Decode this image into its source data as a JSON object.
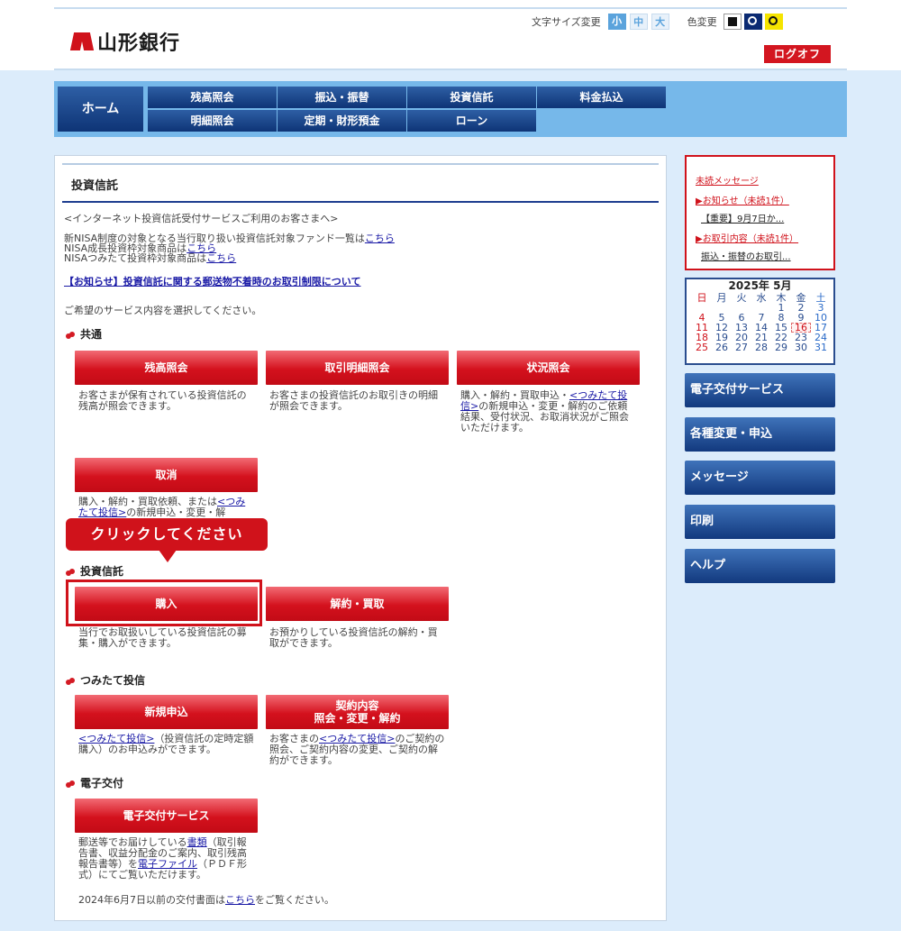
{
  "header": {
    "bank_name": "山形銀行",
    "font_size_label": "文字サイズ変更",
    "font_sizes": [
      "小",
      "中",
      "大"
    ],
    "color_label": "色変更",
    "logoff": "ログオフ"
  },
  "nav": {
    "home": "ホーム",
    "items": [
      "残高照会",
      "振込・振替",
      "投資信託",
      "料金払込",
      "明細照会",
      "定期・財形預金",
      "ローン"
    ]
  },
  "main": {
    "title": "投資信託",
    "intro": "<インターネット投資信託受付サービスご利用のお客さまへ>",
    "nisa_line1_text": "新NISA制度の対象となる当行取り扱い投資信託対象ファンド一覧は",
    "nisa_line2_text": "NISA成長投資枠対象商品は",
    "nisa_line3_text": "NISAつみたて投資枠対象商品は",
    "here_link": "こちら",
    "notice_link": "【お知らせ】投資信託に関する郵送物不着時のお取引制限について",
    "select_prompt": "ご希望のサービス内容を選択してください。",
    "sections": {
      "common": "共通",
      "investment": "投資信託",
      "tsumitate": "つみたて投信",
      "electronic": "電子交付"
    },
    "buttons": {
      "balance": "残高照会",
      "trade_detail": "取引明細照会",
      "status": "状況照会",
      "cancel": "取消",
      "purchase": "購入",
      "redeem": "解約・買取",
      "new_application": "新規申込",
      "contract_line1": "契約内容",
      "contract_line2": "照会・変更・解約",
      "e_delivery": "電子交付サービス"
    },
    "descs": {
      "balance": "お客さまが保有されている投資信託の残高が照会できます。",
      "trade_detail": "お客さまの投資信託のお取引きの明細が照会できます。",
      "status_pre": "購入・解約・買取申込・",
      "status_link": "<つみたて投信>",
      "status_post": "の新規申込・変更・解約のご依頼結果、受付状況、お取消状況がご照会いただけます。",
      "cancel_pre": "購入・解約・買取依頼、または",
      "cancel_link": "<つみたて投信>",
      "cancel_post": "の新規申込・変更・解",
      "purchase": "当行でお取扱いしている投資信託の募集・購入ができます。",
      "redeem": "お預かりしている投資信託の解約・買取ができます。",
      "new_app_link": "<つみたて投信>",
      "new_app_post": "（投資信託の定時定額購入）のお申込みができます。",
      "contract_pre": "お客さまの",
      "contract_link": "<つみたて投信>",
      "contract_post": "のご契約の照会、ご契約内容の変更、ご契約の解約ができます。",
      "e_pre": "郵送等でお届けしている",
      "e_link1": "書類",
      "e_mid": "（取引報告書、収益分配金のご案内、取引残高報告書等）を",
      "e_link2": "電子ファイル",
      "e_post": "（ＰＤＦ形式）にてご覧いただけます。"
    },
    "old_docs_pre": "2024年6月7日以前の交付書面は",
    "old_docs_link": "こちら",
    "old_docs_post": "をご覧ください。"
  },
  "callout": "クリックしてください",
  "messages": {
    "unread": "未読メッセージ",
    "notice": "▶お知らせ（未読1件）",
    "notice_item": "【重要】9月7日か...",
    "trade": "▶お取引内容（未読1件）",
    "trade_item": "振込・振替のお取引..."
  },
  "calendar": {
    "title": "2025年 5月",
    "weekdays": [
      "日",
      "月",
      "火",
      "水",
      "木",
      "金",
      "土"
    ],
    "weeks": [
      [
        "",
        "",
        "",
        "",
        "1",
        "2",
        "3"
      ],
      [
        "4",
        "5",
        "6",
        "7",
        "8",
        "9",
        "10"
      ],
      [
        "11",
        "12",
        "13",
        "14",
        "15",
        "16",
        "17"
      ],
      [
        "18",
        "19",
        "20",
        "21",
        "22",
        "23",
        "24"
      ],
      [
        "25",
        "26",
        "27",
        "28",
        "29",
        "30",
        "31"
      ]
    ],
    "today": "16"
  },
  "side_menu": [
    "電子交付サービス",
    "各種変更・申込",
    "メッセージ",
    "印刷",
    "ヘルプ"
  ]
}
